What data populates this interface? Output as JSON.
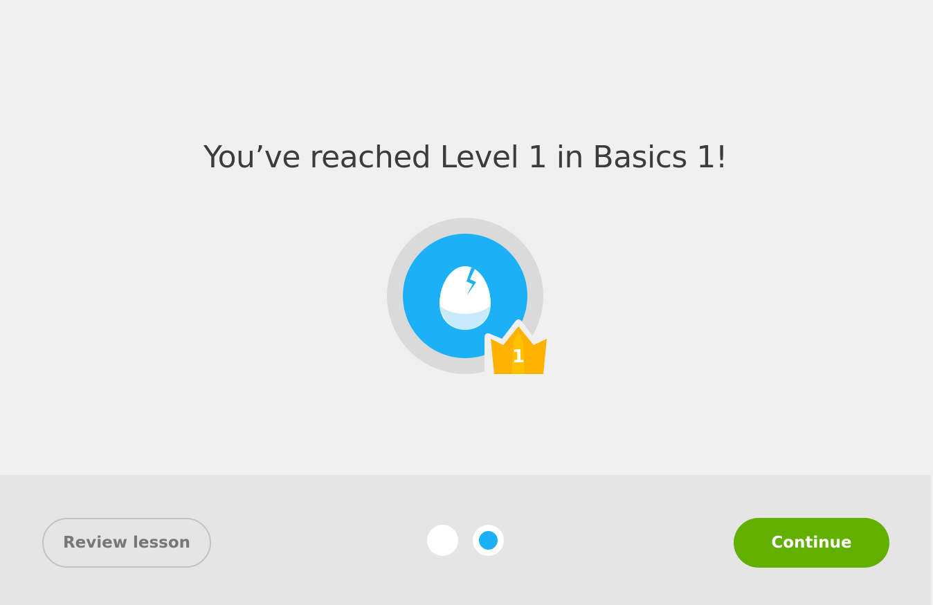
{
  "headline": "You’ve reached Level 1 in Basics 1!",
  "badge": {
    "icon": "cracked-egg-icon",
    "crown_icon": "crown-icon",
    "crown_level": "1",
    "colors": {
      "ring": "#dadada",
      "circle": "#1cb0f6",
      "crown": "#ffb100"
    }
  },
  "footer": {
    "review_label": "Review lesson",
    "continue_label": "Continue",
    "pager": {
      "total": 2,
      "active": 2
    },
    "colors": {
      "continue": "#61b000",
      "active_dot": "#1cb0f6"
    }
  }
}
